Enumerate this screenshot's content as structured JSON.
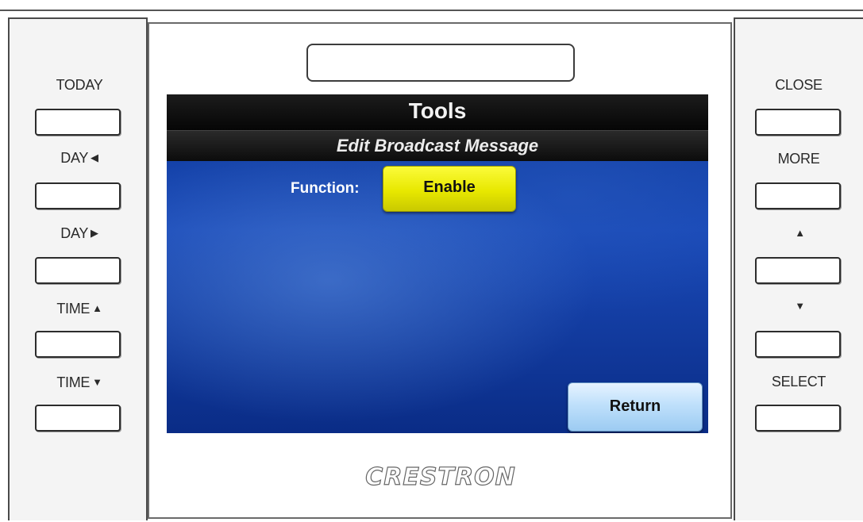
{
  "left_buttons": [
    {
      "label": "TODAY",
      "arrow": ""
    },
    {
      "label": "DAY",
      "arrow": "◀"
    },
    {
      "label": "DAY",
      "arrow": "▶"
    },
    {
      "label": "TIME",
      "arrow": "▲"
    },
    {
      "label": "TIME",
      "arrow": "▼"
    }
  ],
  "right_buttons": [
    {
      "label": "CLOSE",
      "arrow": ""
    },
    {
      "label": "MORE",
      "arrow": ""
    },
    {
      "label": "",
      "arrow": "▲"
    },
    {
      "label": "",
      "arrow": "▼"
    },
    {
      "label": "SELECT",
      "arrow": ""
    }
  ],
  "screen": {
    "title": "Tools",
    "subtitle": "Edit Broadcast Message",
    "function_label": "Function:",
    "function_value": "Enable",
    "return_label": "Return"
  },
  "brand": "CRESTRON",
  "colors": {
    "enable_button": "#e8e800",
    "return_button": "#bfe0fb",
    "screen_background": "#1a4ab8",
    "header_background": "#0a0a0a"
  }
}
